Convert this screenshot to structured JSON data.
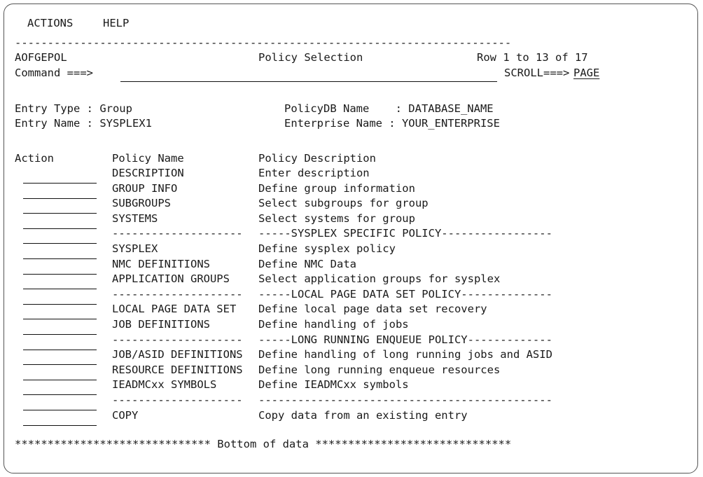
{
  "menu": [
    "ACTIONS",
    "HELP"
  ],
  "separator": "----------------------------------------------------------------------------",
  "panel_id": "AOFGEPOL",
  "title": "Policy Selection",
  "row_info": "Row 1 to 13 of 17",
  "command_label": "Command ===>",
  "command_value": "",
  "scroll_label": "SCROLL===>",
  "scroll_value": "PAGE",
  "entry_type_label": "Entry Type : Group",
  "entry_name_label": "Entry Name : SYSPLEX1",
  "policydb_label": "PolicyDB Name    : DATABASE_NAME",
  "enterprise_label": "Enterprise Name : YOUR_ENTERPRISE",
  "headers": {
    "action": "Action",
    "name": "Policy Name",
    "desc": "Policy Description"
  },
  "rows": [
    {
      "name": "DESCRIPTION",
      "desc": "Enter description"
    },
    {
      "name": "GROUP INFO",
      "desc": "Define group information"
    },
    {
      "name": "SUBGROUPS",
      "desc": "Select subgroups for group"
    },
    {
      "name": "SYSTEMS",
      "desc": "Select systems for group"
    },
    {
      "name": "--------------------",
      "desc": "-----SYSPLEX SPECIFIC POLICY-----------------"
    },
    {
      "name": "SYSPLEX",
      "desc": "Define sysplex policy"
    },
    {
      "name": "NMC DEFINITIONS",
      "desc": "Define NMC Data"
    },
    {
      "name": "APPLICATION GROUPS",
      "desc": "Select application groups for sysplex"
    },
    {
      "name": "--------------------",
      "desc": "-----LOCAL PAGE DATA SET POLICY--------------"
    },
    {
      "name": "LOCAL PAGE DATA SET",
      "desc": "Define local page data set recovery"
    },
    {
      "name": "JOB DEFINITIONS",
      "desc": "Define handling of jobs"
    },
    {
      "name": "--------------------",
      "desc": "-----LONG RUNNING ENQUEUE POLICY-------------"
    },
    {
      "name": "JOB/ASID DEFINITIONS",
      "desc": "Define handling of long running jobs and ASID"
    },
    {
      "name": "RESOURCE DEFINITIONS",
      "desc": "Define long running enqueue resources"
    },
    {
      "name": "IEADMCxx SYMBOLS",
      "desc": "Define IEADMCxx symbols"
    },
    {
      "name": "--------------------",
      "desc": "---------------------------------------------"
    },
    {
      "name": "COPY",
      "desc": "Copy data from an existing entry"
    }
  ],
  "bottom": "****************************** Bottom of data ******************************"
}
